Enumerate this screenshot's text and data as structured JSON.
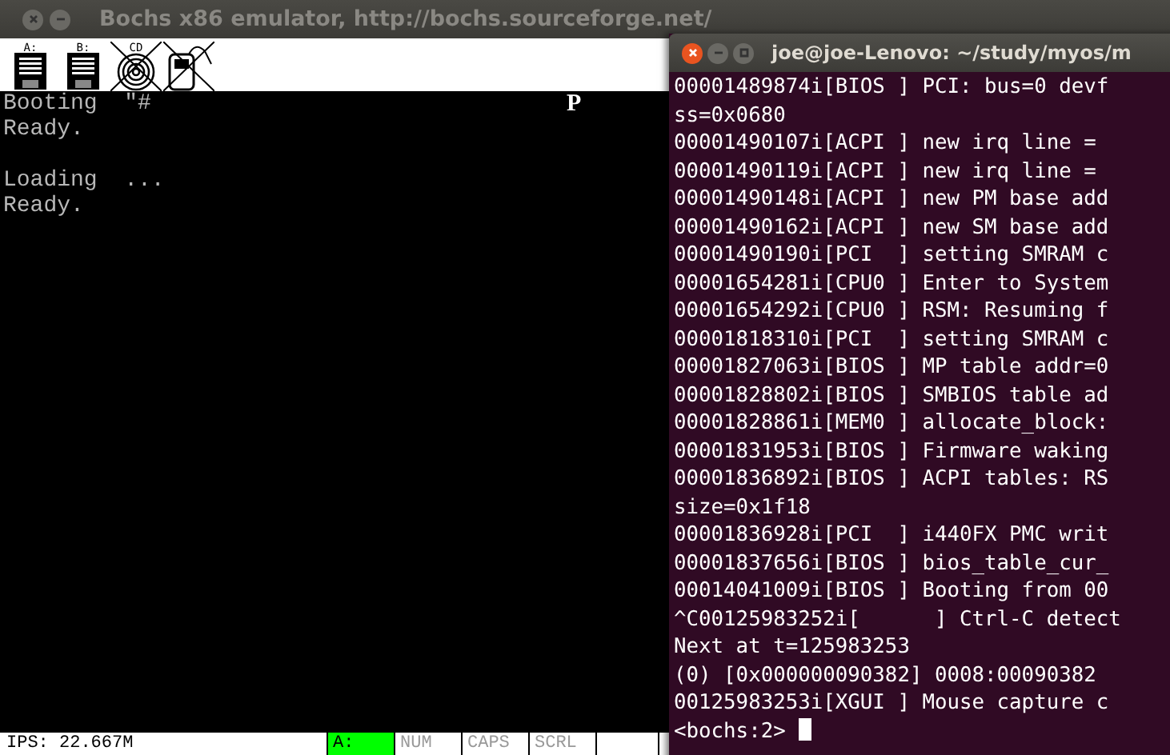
{
  "bochs_window": {
    "title": "Bochs x86 emulator, http://bochs.sourceforge.net/",
    "toolbar": [
      {
        "kind": "floppy",
        "label": "A:",
        "disabled": false
      },
      {
        "kind": "floppy",
        "label": "B:",
        "disabled": false
      },
      {
        "kind": "cdrom",
        "label": "CD",
        "disabled": true
      },
      {
        "kind": "mouse",
        "disabled": true
      }
    ],
    "screen_blocks": [
      [
        "Booting  \"#",
        "Ready."
      ],
      [
        "Loading  ...",
        "Ready."
      ]
    ],
    "screen_marker": "P",
    "status_bar": {
      "ips": "IPS: 22.667M",
      "lamps": [
        {
          "label": "A:",
          "on": true
        },
        {
          "label": "NUM",
          "on": false
        },
        {
          "label": "CAPS",
          "on": false
        },
        {
          "label": "SCRL",
          "on": false
        }
      ]
    }
  },
  "terminal_window": {
    "title": "joe@joe-Lenovo: ~/study/myos/m",
    "lines": [
      "00001489874i[BIOS ] PCI: bus=0 devf",
      "ss=0x0680",
      "00001490107i[ACPI ] new irq line =",
      "00001490119i[ACPI ] new irq line =",
      "00001490148i[ACPI ] new PM base add",
      "00001490162i[ACPI ] new SM base add",
      "00001490190i[PCI  ] setting SMRAM c",
      "00001654281i[CPU0 ] Enter to System",
      "00001654292i[CPU0 ] RSM: Resuming f",
      "00001818310i[PCI  ] setting SMRAM c",
      "00001827063i[BIOS ] MP table addr=0",
      "00001828802i[BIOS ] SMBIOS table ad",
      "00001828861i[MEM0 ] allocate_block:",
      "00001831953i[BIOS ] Firmware waking",
      "00001836892i[BIOS ] ACPI tables: RS",
      "size=0x1f18",
      "00001836928i[PCI  ] i440FX PMC writ",
      "00001837656i[BIOS ] bios_table_cur_",
      "00014041009i[BIOS ] Booting from 00",
      "^C00125983252i[      ] Ctrl-C detect",
      "Next at t=125983253",
      "(0) [0x000000090382] 0008:00090382",
      "00125983253i[XGUI ] Mouse capture c",
      "<bochs:2>"
    ]
  }
}
